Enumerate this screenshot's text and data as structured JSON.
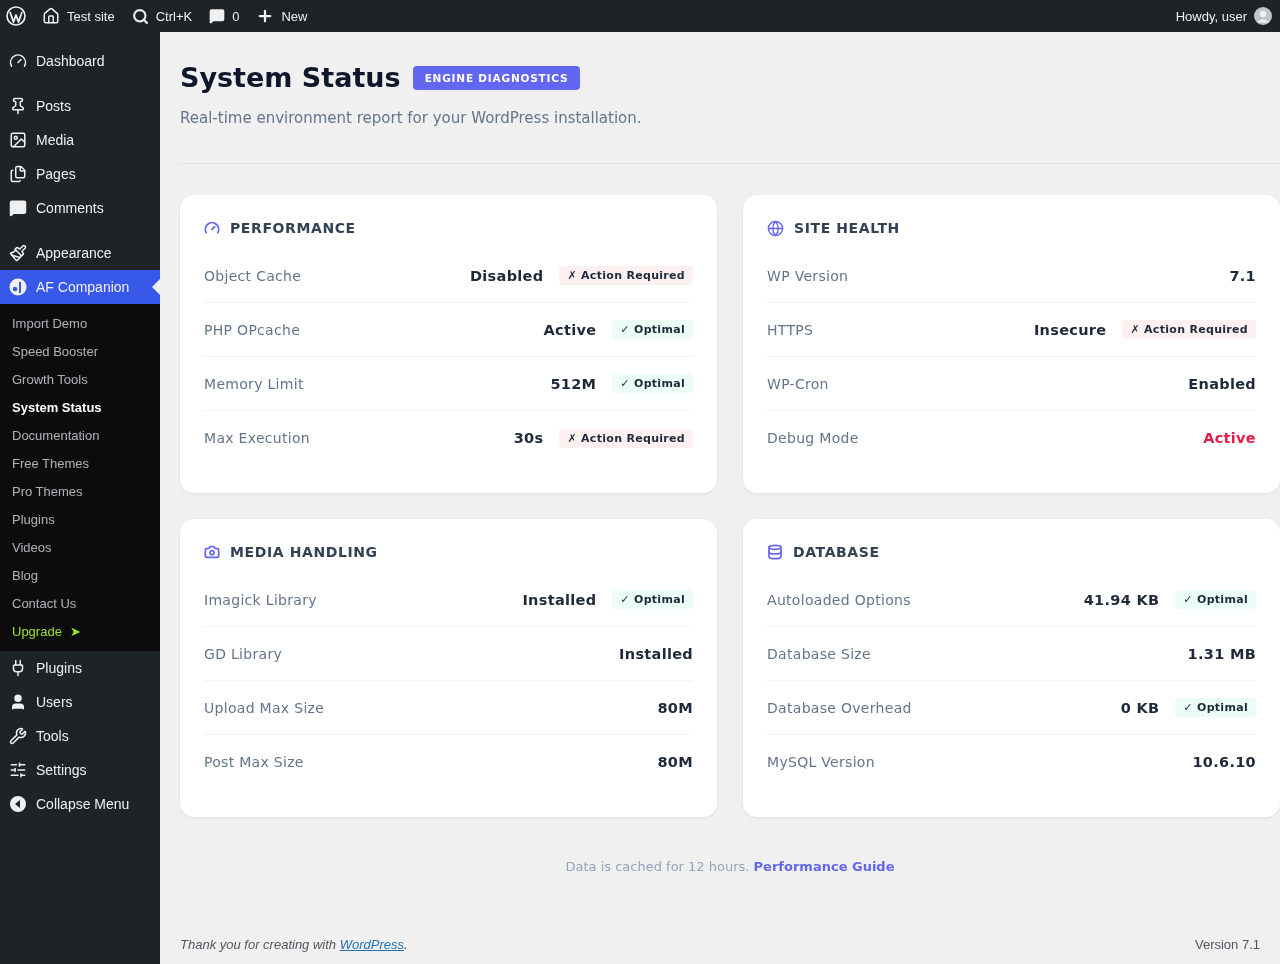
{
  "admin_bar": {
    "site": "Test site",
    "search": "Ctrl+K",
    "comments": "0",
    "new": "New",
    "greeting": "Howdy, user"
  },
  "sidebar": {
    "groups": [
      [
        {
          "label": "Dashboard",
          "kind": "dashboard",
          "selected": false
        }
      ],
      [
        {
          "label": "Posts",
          "kind": "posts",
          "selected": false
        },
        {
          "label": "Media",
          "kind": "media",
          "selected": false
        },
        {
          "label": "Pages",
          "kind": "pages",
          "selected": false
        },
        {
          "label": "Comments",
          "kind": "comments",
          "selected": false
        }
      ],
      [
        {
          "label": "Appearance",
          "kind": "appearance",
          "selected": false
        },
        {
          "label": "AF Companion",
          "kind": "companion",
          "selected": true,
          "submenu": [
            {
              "label": "Import Demo",
              "kind": "link",
              "selected": false
            },
            {
              "label": "Speed Booster",
              "kind": "link",
              "selected": false
            },
            {
              "label": "Growth Tools",
              "kind": "link",
              "selected": false
            },
            {
              "label": "System Status",
              "kind": "link",
              "selected": true
            },
            {
              "label": "Documentation",
              "kind": "link",
              "selected": false
            },
            {
              "label": "Free Themes",
              "kind": "link",
              "selected": false
            },
            {
              "label": "Pro Themes",
              "kind": "link",
              "selected": false
            },
            {
              "label": "Plugins",
              "kind": "link",
              "selected": false
            },
            {
              "label": "Videos",
              "kind": "link",
              "selected": false
            },
            {
              "label": "Blog",
              "kind": "link",
              "selected": false
            },
            {
              "label": "Contact Us",
              "kind": "link",
              "selected": false
            },
            {
              "label": "Upgrade",
              "kind": "upgrade",
              "arrow": "➤",
              "selected": false
            }
          ]
        },
        {
          "label": "Plugins",
          "kind": "plugins",
          "selected": false
        },
        {
          "label": "Users",
          "kind": "users",
          "selected": false
        },
        {
          "label": "Tools",
          "kind": "tools",
          "selected": false
        },
        {
          "label": "Settings",
          "kind": "settings",
          "selected": false
        },
        {
          "label": "Collapse Menu",
          "kind": "collapse",
          "selected": false
        }
      ]
    ]
  },
  "header": {
    "title": "System Status",
    "badge": "ENGINE DIAGNOSTICS",
    "subtitle": "Real-time environment report for your WordPress installation."
  },
  "cards": [
    {
      "title": "PERFORMANCE",
      "kind": "gauge",
      "rows": [
        {
          "label": "Object Cache",
          "value": "Disabled",
          "alert": false,
          "status": {
            "kind": "action",
            "text": "✗ Action Required"
          }
        },
        {
          "label": "PHP OPcache",
          "value": "Active",
          "alert": false,
          "status": {
            "kind": "optimal",
            "text": "✓ Optimal"
          }
        },
        {
          "label": "Memory Limit",
          "value": "512M",
          "alert": false,
          "status": {
            "kind": "optimal",
            "text": "✓ Optimal"
          }
        },
        {
          "label": "Max Execution",
          "value": "30s",
          "alert": false,
          "status": {
            "kind": "action",
            "text": "✗ Action Required"
          }
        }
      ]
    },
    {
      "title": "SITE HEALTH",
      "kind": "globe",
      "rows": [
        {
          "label": "WP Version",
          "value": "7.1",
          "alert": false
        },
        {
          "label": "HTTPS",
          "value": "Insecure",
          "alert": false,
          "status": {
            "kind": "action",
            "text": "✗ Action Required"
          }
        },
        {
          "label": "WP-Cron",
          "value": "Enabled",
          "alert": false
        },
        {
          "label": "Debug Mode",
          "value": "Active",
          "alert": true
        }
      ]
    },
    {
      "title": "MEDIA HANDLING",
      "kind": "camera",
      "rows": [
        {
          "label": "Imagick Library",
          "value": "Installed",
          "alert": false,
          "status": {
            "kind": "optimal",
            "text": "✓ Optimal"
          }
        },
        {
          "label": "GD Library",
          "value": "Installed",
          "alert": false
        },
        {
          "label": "Upload Max Size",
          "value": "80M",
          "alert": false
        },
        {
          "label": "Post Max Size",
          "value": "80M",
          "alert": false
        }
      ]
    },
    {
      "title": "DATABASE",
      "kind": "database",
      "rows": [
        {
          "label": "Autoloaded Options",
          "value": "41.94 KB",
          "alert": false,
          "status": {
            "kind": "optimal",
            "text": "✓ Optimal"
          }
        },
        {
          "label": "Database Size",
          "value": "1.31 MB",
          "alert": false
        },
        {
          "label": "Database Overhead",
          "value": "0 KB",
          "alert": false,
          "status": {
            "kind": "optimal",
            "text": "✓ Optimal"
          }
        },
        {
          "label": "MySQL Version",
          "value": "10.6.10",
          "alert": false
        }
      ]
    }
  ],
  "note": {
    "text": "Data is cached for 12 hours.",
    "link": "Performance Guide"
  },
  "footer": {
    "text": "Thank you for creating with",
    "link": "WordPress",
    "suffix": ".",
    "version": "Version 7.1"
  }
}
